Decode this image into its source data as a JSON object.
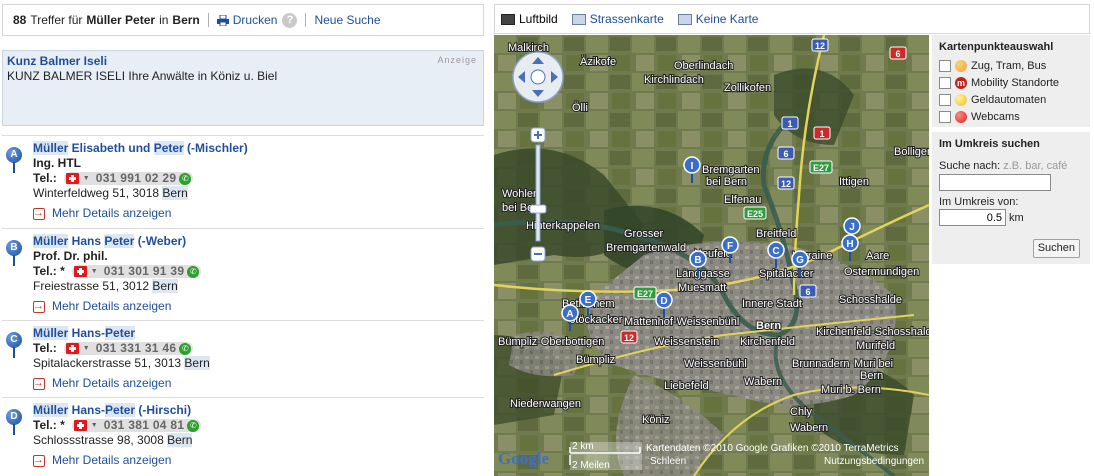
{
  "header": {
    "count": "88",
    "text_treffer": "Treffer für",
    "query_name": "Müller Peter",
    "text_in": "in",
    "query_city": "Bern",
    "print_label": "Drucken",
    "help_label": "?",
    "new_search_label": "Neue Suche"
  },
  "ad": {
    "title": "Kunz Balmer Iseli",
    "text": "KUNZ BALMER ISELI Ihre Anwälte in Köniz u. Biel",
    "tag": "Anzeige"
  },
  "results": [
    {
      "letter": "A",
      "name_parts": [
        "Müller",
        " Elisabeth und ",
        "Peter",
        " (-Mischler)"
      ],
      "title": "Ing. HTL",
      "tel_label": "Tel.:",
      "phone": "031 991 02 29",
      "address": "Winterfeldweg 51, 3018 ",
      "city": "Bern",
      "more": "Mehr Details anzeigen"
    },
    {
      "letter": "B",
      "name_parts": [
        "Müller",
        " Hans ",
        "Peter",
        " (-Weber)"
      ],
      "title": "Prof. Dr. phil.",
      "tel_label": "Tel.: *",
      "phone": "031 301 91 39",
      "address": "Freiestrasse 51, 3012 ",
      "city": "Bern",
      "more": "Mehr Details anzeigen"
    },
    {
      "letter": "C",
      "name_parts": [
        "Müller",
        " Hans-",
        "Peter",
        ""
      ],
      "title": "",
      "tel_label": "Tel.:",
      "phone": "031 331 31 46",
      "address": "Spitalackerstrasse 51, 3013 ",
      "city": "Bern",
      "more": "Mehr Details anzeigen"
    },
    {
      "letter": "D",
      "name_parts": [
        "Müller",
        " Hans-",
        "Peter",
        " (-Hirschi)"
      ],
      "title": "",
      "tel_label": "Tel.: *",
      "phone": "031 381 04 81",
      "address": "Schlossstrasse 98, 3008 ",
      "city": "Bern",
      "more": "Mehr Details anzeigen"
    }
  ],
  "map_tabs": [
    {
      "label": "Luftbild",
      "active": true
    },
    {
      "label": "Strassenkarte",
      "active": false
    },
    {
      "label": "Keine Karte",
      "active": false
    }
  ],
  "map": {
    "places": [
      "Malkirch",
      "Äzikofe",
      "Oberlindach",
      "Kirchlindach",
      "Zollikofen",
      "Ölli",
      "Bremgarten",
      "bei Bern",
      "Elfenau",
      "Ittigen",
      "Bolligen",
      "Wohlen",
      "bei Bern",
      "Hinterkappelen",
      "Grosser",
      "Bremgartenwald",
      "Breitfeld",
      "Neufeld",
      "Lorraine",
      "Spitalacker",
      "Ostermundigen",
      "Länggasse",
      "Muesmatt",
      "Innere Stadt",
      "Schosshalde",
      "Bethlehem",
      "Stöckacker",
      "Mattenhof-Weissenbühl",
      "Bern",
      "Kirchenfeld-Schosshalde",
      "Bümpliz-Oberbottigen",
      "Weissenstein",
      "Kirchenfeld",
      "Murifeld",
      "Bümpliz",
      "Weissenbühl",
      "Brunnadern",
      "Muri bei",
      "Bern",
      "Liebefeld",
      "Wabern",
      "Muri b. Bern",
      "Niederwangen",
      "Köniz",
      "Chly",
      "Wabern",
      "Aare"
    ],
    "roads": [
      "12",
      "6",
      "1",
      "6",
      "12",
      "1",
      "E27",
      "E25",
      "E27",
      "6",
      "12"
    ],
    "markers": [
      "I",
      "F",
      "C",
      "G",
      "J",
      "H",
      "B",
      "E",
      "D",
      "A"
    ],
    "scale_km": "2 km",
    "scale_mi": "2 Meilen",
    "attribution": "Kartendaten ©2010 Google Grafiken ©2010 TerraMetrics",
    "attribution2": "Schleen",
    "attribution3": "Nutzungsbedingungen",
    "brand": "Google"
  },
  "sidebar": {
    "kp_title": "Kartenpunkteauswahl",
    "kp_items": [
      {
        "label": "Zug, Tram, Bus",
        "color": "#e8a53a"
      },
      {
        "label": "Mobility Standorte",
        "color": "#c0221b",
        "letter": "m"
      },
      {
        "label": "Geldautomaten",
        "color": "#e9c21d"
      },
      {
        "label": "Webcams",
        "color": "#d12620"
      }
    ],
    "um_title": "Im Umkreis suchen",
    "search_label": "Suche nach:",
    "search_hint": "z.B. bar, café",
    "radius_label": "Im Umkreis von:",
    "radius_value": "0.5",
    "radius_unit": "km",
    "button_label": "Suchen"
  }
}
